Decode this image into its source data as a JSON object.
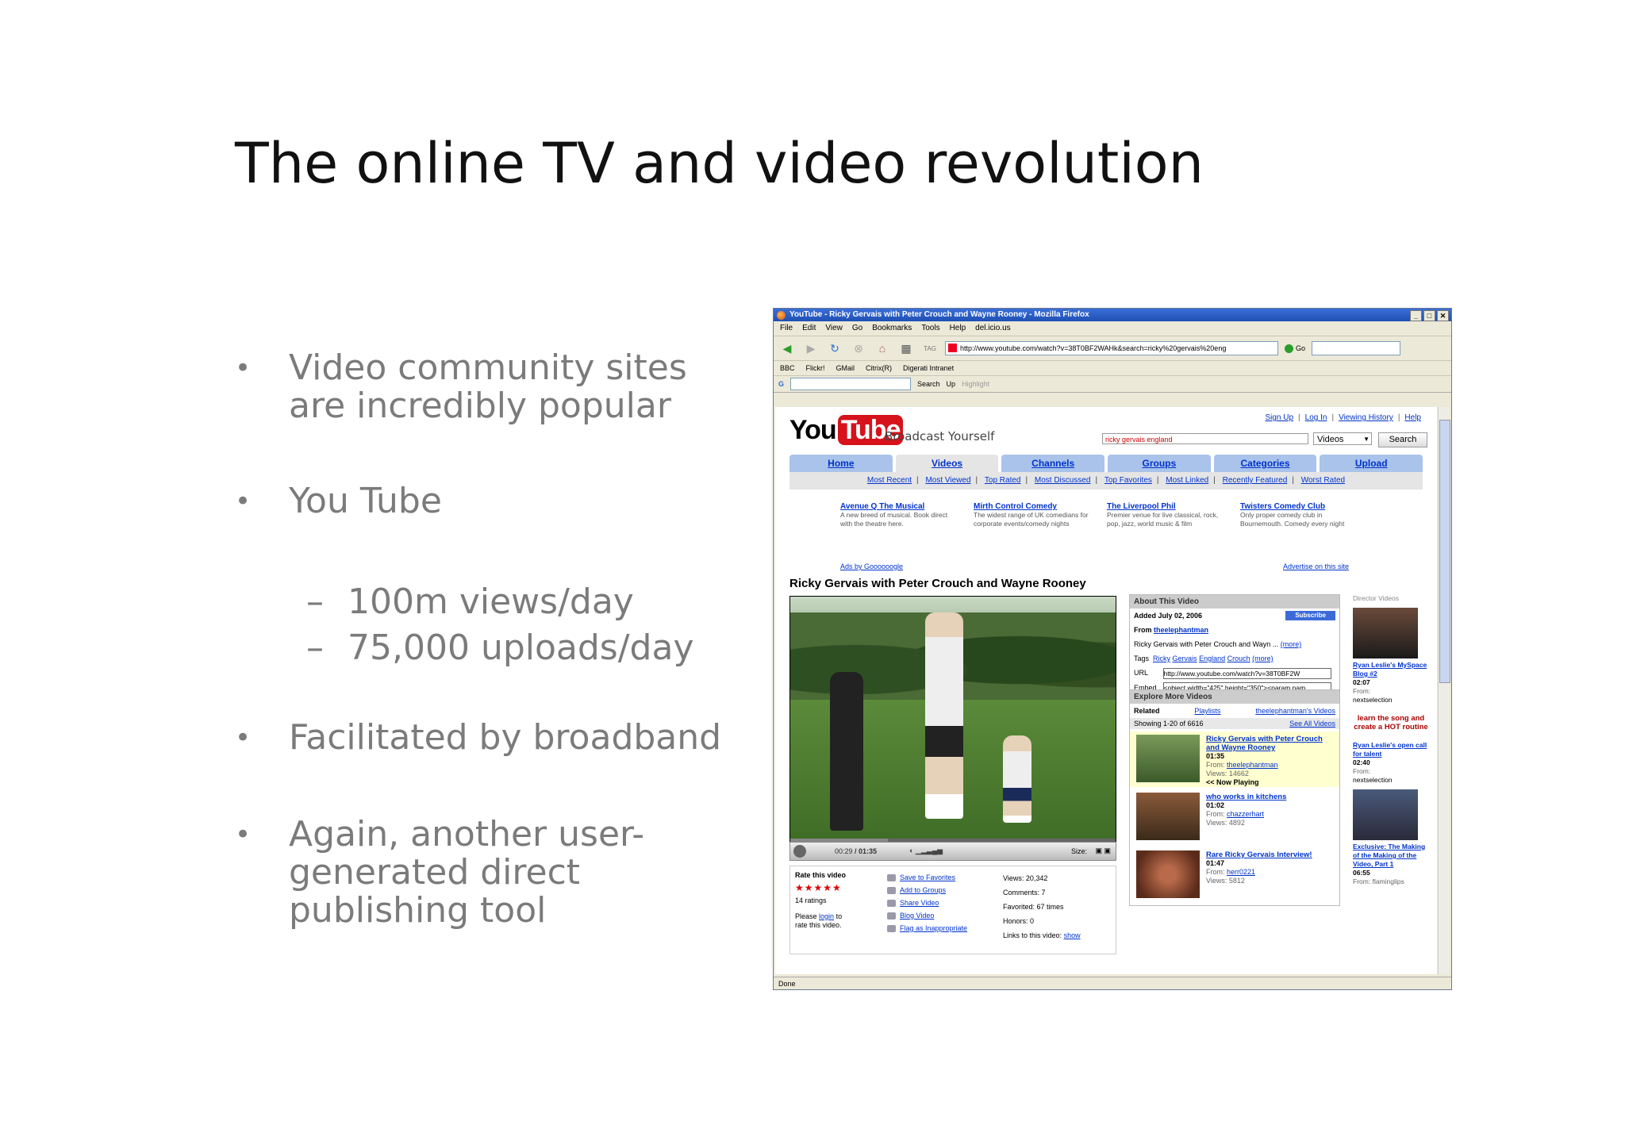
{
  "slide": {
    "title": "The online TV and video revolution",
    "bullets": [
      "Video community sites are incredibly popular",
      "You Tube",
      "Facilitated by broadband",
      "Again, another user-generated direct publishing tool"
    ],
    "sub_bullets": [
      "100m views/day",
      "75,000 uploads/day"
    ],
    "bullet_glyph": "•",
    "dash_glyph": "–"
  },
  "browser": {
    "window_title": "YouTube - Ricky Gervais with Peter Crouch and Wayne Rooney - Mozilla Firefox",
    "menu": [
      "File",
      "Edit",
      "View",
      "Go",
      "Bookmarks",
      "Tools",
      "Help",
      "del.icio.us"
    ],
    "url": "http://www.youtube.com/watch?v=38T0BF2WAHk&search=ricky%20gervais%20eng",
    "go_label": "Go",
    "bookmarks": [
      "BBC",
      "Flickr!",
      "GMail",
      "Citrix(R)",
      "Digerati Intranet"
    ],
    "gbar": [
      "Search",
      "Up",
      "Highlight"
    ],
    "status": "Done"
  },
  "youtube": {
    "logo_you": "You",
    "logo_tube": "Tube",
    "slogan": "Broadcast Yourself",
    "toplinks": [
      "Sign Up",
      "Log In",
      "Viewing History",
      "Help"
    ],
    "search_value": "ricky gervais england",
    "search_scope": "Videos",
    "search_button": "Search",
    "tabs": [
      "Home",
      "Videos",
      "Channels",
      "Groups",
      "Categories",
      "Upload"
    ],
    "subnav": [
      "Most Recent",
      "Most Viewed",
      "Top Rated",
      "Most Discussed",
      "Top Favorites",
      "Most Linked",
      "Recently Featured",
      "Worst Rated"
    ],
    "ads": [
      {
        "title": "Avenue Q The Musical",
        "desc": "A new breed of musical. Book direct with the theatre here."
      },
      {
        "title": "Mirth Control Comedy",
        "desc": "The widest range of UK comedians for corporate events/comedy nights"
      },
      {
        "title": "The Liverpool Phil",
        "desc": "Premier venue for live classical, rock, pop, jazz, world music & film"
      },
      {
        "title": "Twisters Comedy Club",
        "desc": "Only proper comedy club in Bournemouth. Comedy every night"
      }
    ],
    "ads_by": "Ads by Goooooogle",
    "advertise": "Advertise on this site",
    "video_title": "Ricky Gervais with Peter Crouch and Wayne Rooney",
    "player": {
      "time_current": "00:29",
      "time_total": "/ 01:35",
      "size_label": "Size:",
      "progress": 0.3
    },
    "rate": {
      "title": "Rate this video",
      "stars": "★★★★★",
      "ratings": "14 ratings",
      "please": "Please",
      "login": "login",
      "to_rate": "to rate this video."
    },
    "actions": [
      "Save to Favorites",
      "Add to Groups",
      "Share Video",
      "Blog Video",
      "Flag as Inappropriate"
    ],
    "stats": {
      "views": "Views: 20,342",
      "comments": "Comments: 7",
      "favorited": "Favorited: 67 times",
      "honors": "Honors: 0",
      "links": "Links to this video:",
      "show": "show"
    },
    "about": {
      "header": "About This Video",
      "added_label": "Added",
      "added_date": "July 02, 2006",
      "subscribe": "Subscribe",
      "from_label": "From",
      "from_user": "theelephantman",
      "description": "Ricky Gervais with Peter Crouch and Wayn ...",
      "more": "(more)",
      "tags_label": "Tags",
      "tags": [
        "Ricky",
        "Gervais",
        "England",
        "Crouch"
      ],
      "tags_more": "(more)",
      "url_label": "URL",
      "url_value": "http://www.youtube.com/watch?v=38T0BF2W",
      "embed_label": "Embed",
      "embed_value": "<object width=\"425\" height=\"350\"><param nam"
    },
    "explore": {
      "header": "Explore More Videos",
      "tab_related": "Related",
      "tab_playlists": "Playlists",
      "tab_user": "theelephantman's Videos",
      "showing": "Showing 1-20 of 6616",
      "see_all": "See All Videos",
      "items": [
        {
          "title": "Ricky Gervais with Peter Crouch and Wayne Rooney",
          "duration": "01:35",
          "from": "theelephantman",
          "views": "Views: 14662",
          "now_playing": "<< Now Playing"
        },
        {
          "title": "who works in kitchens",
          "duration": "01:02",
          "from": "chazzerhart",
          "views": "Views: 4892",
          "now_playing": ""
        },
        {
          "title": "Rare Ricky Gervais Interview!",
          "duration": "01:47",
          "from": "herr0221",
          "views": "Views: 5812",
          "now_playing": ""
        }
      ],
      "from_label": "From:"
    },
    "director": {
      "header": "Director Videos",
      "items": [
        {
          "title": "Ryan Leslie's MySpace Blog #2",
          "duration": "02:07",
          "from_label": "From:",
          "from": "nextselection"
        },
        {
          "title": "Ryan Leslie's open call for talent",
          "duration": "02:40",
          "from_label": "From:",
          "from": "nextselection"
        },
        {
          "title": "Exclusive: The Making of the Making of the Video, Part 1",
          "duration": "06:55",
          "from_label": "From:",
          "from": "flaminglips"
        }
      ],
      "promo": "learn the song and create a HOT routine"
    }
  }
}
